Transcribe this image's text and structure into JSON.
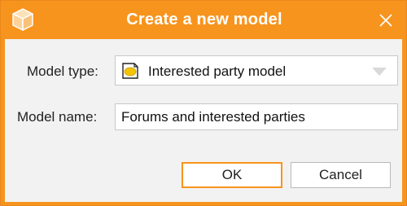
{
  "dialog": {
    "title": "Create a new model",
    "accent_color": "#f7941d",
    "app_icon": "cube-icon",
    "close_icon": "close-icon"
  },
  "form": {
    "model_type_label": "Model type:",
    "model_type_value": "Interested party model",
    "model_type_icon": "interested-party-model-icon",
    "model_name_label": "Model name:",
    "model_name_value": "Forums and interested parties"
  },
  "buttons": {
    "ok_label": "OK",
    "cancel_label": "Cancel"
  }
}
